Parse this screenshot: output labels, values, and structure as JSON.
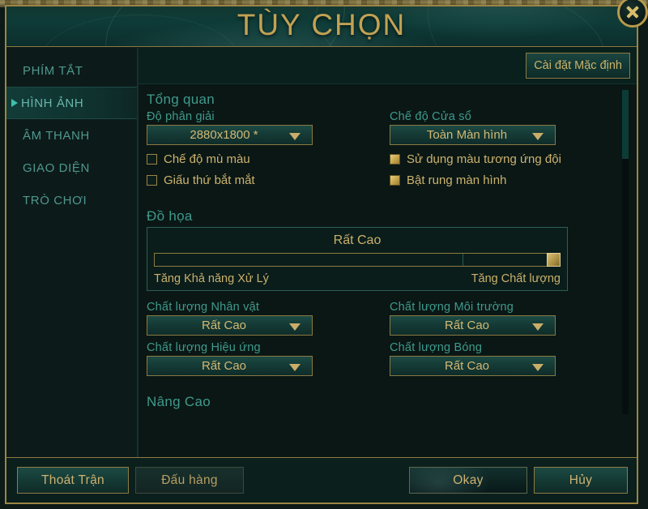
{
  "window": {
    "title": "TÙY CHỌN",
    "close_icon": "close-icon"
  },
  "sidebar": {
    "items": [
      {
        "label": "PHÍM TẮT",
        "active": false
      },
      {
        "label": "HÌNH ẢNH",
        "active": true
      },
      {
        "label": "ÂM THANH",
        "active": false
      },
      {
        "label": "GIAO DIỆN",
        "active": false
      },
      {
        "label": "TRÒ CHƠI",
        "active": false
      }
    ]
  },
  "toolbar": {
    "defaults_label": "Cài đặt Mặc định"
  },
  "sections": {
    "overview": {
      "title": "Tổng quan",
      "resolution": {
        "label": "Độ phân giải",
        "value": "2880x1800 *"
      },
      "window_mode": {
        "label": "Chế độ Cửa sổ",
        "value": "Toàn Màn hình"
      },
      "checkboxes_left": [
        {
          "label": "Chế độ mù màu",
          "checked": false
        },
        {
          "label": "Giấu thứ bắt mắt",
          "checked": false
        }
      ],
      "checkboxes_right": [
        {
          "label": "Sử dụng màu tương ứng đội",
          "checked": true
        },
        {
          "label": "Bật rung màn hình",
          "checked": true
        }
      ]
    },
    "graphics": {
      "title": "Đồ họa",
      "slider": {
        "value_label": "Rất Cao",
        "left_label": "Tăng Khả năng Xử Lý",
        "right_label": "Tăng Chất lượng",
        "percent": 100
      },
      "dropdowns": [
        {
          "label": "Chất lượng Nhân vật",
          "value": "Rất Cao"
        },
        {
          "label": "Chất lượng Môi trường",
          "value": "Rất Cao"
        },
        {
          "label": "Chất lượng Hiệu ứng",
          "value": "Rất Cao"
        },
        {
          "label": "Chất lượng Bóng",
          "value": "Rất Cao"
        }
      ]
    },
    "advanced": {
      "title": "Nâng Cao"
    }
  },
  "footer": {
    "quit_label": "Thoát Trận",
    "surrender_label": "Đấu hàng",
    "okay_label": "Okay",
    "cancel_label": "Hủy"
  },
  "colors": {
    "gold": "#c2a253",
    "teal": "#3f9a8c",
    "accent_arrow": "#3fbfae"
  }
}
